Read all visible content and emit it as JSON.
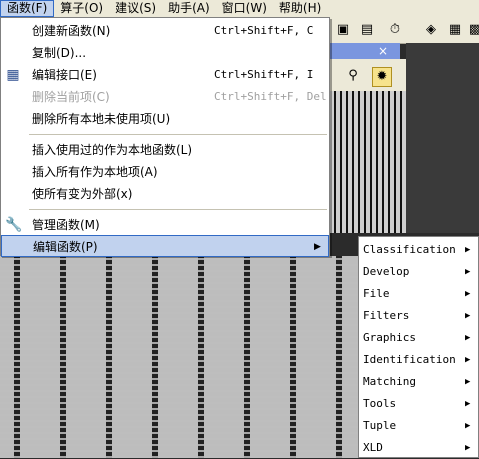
{
  "menubar": {
    "items": [
      "函数(F)",
      "算子(O)",
      "建议(S)",
      "助手(A)",
      "窗口(W)",
      "帮助(H)"
    ]
  },
  "dropdown": {
    "items": [
      {
        "label": "创建新函数(N)",
        "shortcut": "Ctrl+Shift+F, C"
      },
      {
        "label": "复制(D)...",
        "shortcut": ""
      },
      {
        "label": "编辑接口(E)",
        "shortcut": "Ctrl+Shift+F, I"
      },
      {
        "label": "删除当前项(C)",
        "shortcut": "Ctrl+Shift+F, Del"
      },
      {
        "label": "删除所有本地未使用项(U)",
        "shortcut": ""
      },
      {
        "label": "插入使用过的作为本地函数(L)",
        "shortcut": ""
      },
      {
        "label": "插入所有作为本地项(A)",
        "shortcut": ""
      },
      {
        "label": "使所有变为外部(x)",
        "shortcut": ""
      },
      {
        "label": "管理函数(M)",
        "shortcut": ""
      },
      {
        "label": "编辑函数(P)",
        "shortcut": ""
      }
    ]
  },
  "submenu": {
    "items": [
      "Classification",
      "Develop",
      "File",
      "Filters",
      "Graphics",
      "Identification",
      "Matching",
      "Tools",
      "Tuple",
      "XLD"
    ]
  },
  "subwindow": {
    "close": "×"
  },
  "icons": {
    "edit_interface": "table-icon",
    "manage": "wrench-icon",
    "arrow": "▶"
  }
}
